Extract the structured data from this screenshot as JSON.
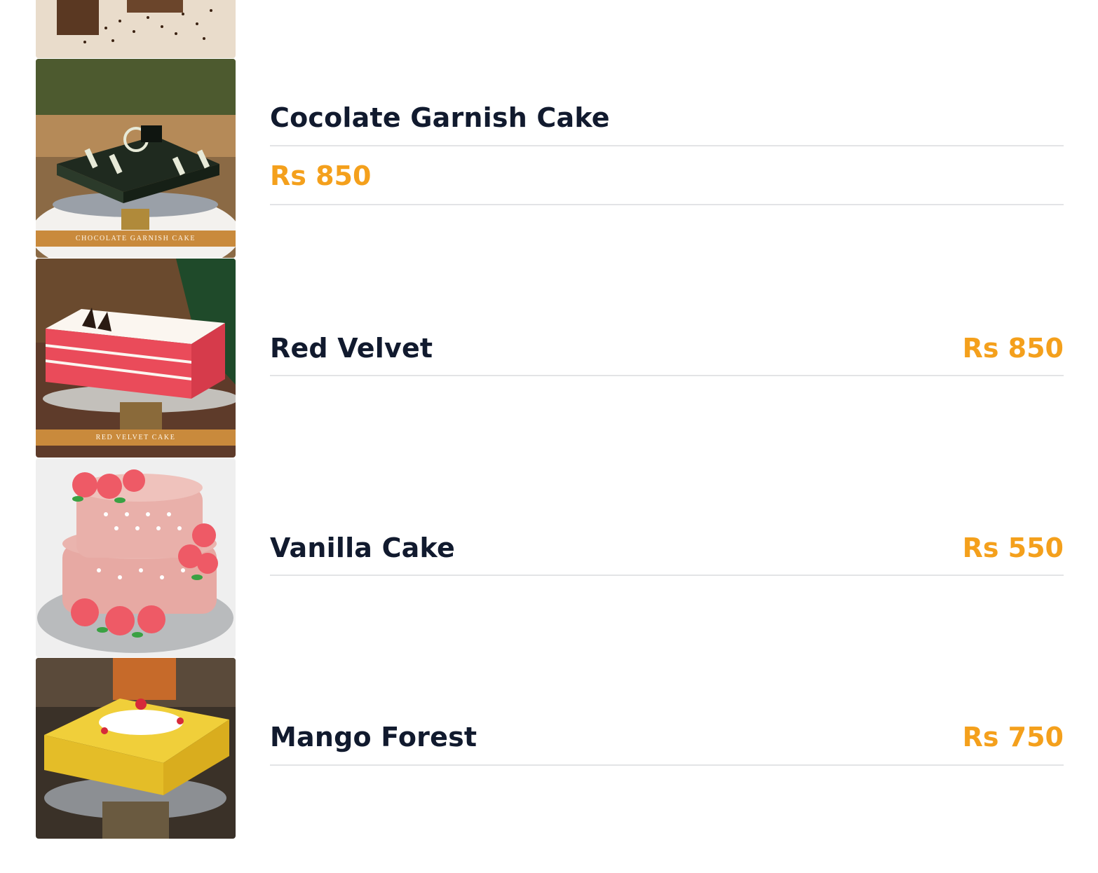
{
  "menu": {
    "items": [
      {
        "name": "Cocolate Garnish Cake",
        "price": "Rs 850",
        "image_caption": "CHOCOLATE GARNISH CAKE"
      },
      {
        "name": "Red Velvet",
        "price": "Rs 850",
        "image_caption": "RED VELVET CAKE"
      },
      {
        "name": "Vanilla Cake",
        "price": "Rs 550"
      },
      {
        "name": "Mango Forest",
        "price": "Rs 750"
      }
    ]
  },
  "colors": {
    "name_text": "#111a2e",
    "price_text": "#f4a01c",
    "divider": "#e3e4e6",
    "caption_band": "#c98a3c"
  }
}
